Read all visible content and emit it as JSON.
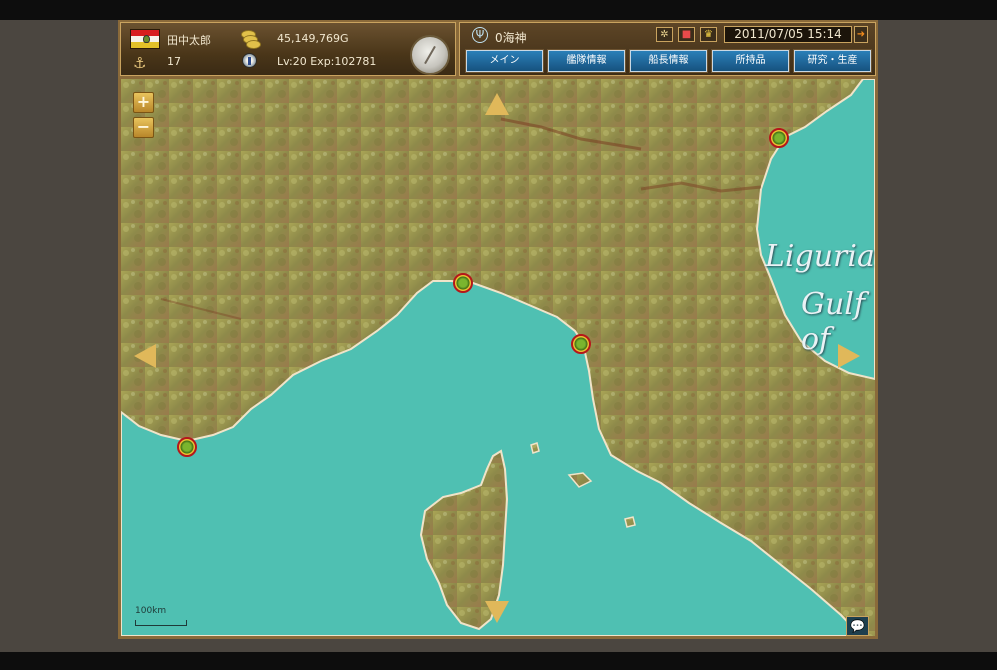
{
  "player": {
    "name": "田中太郎",
    "gold": "45,149,769G",
    "level_exp": "Lv:20 Exp:102781",
    "anchor_count": "17"
  },
  "ship": {
    "name": "0海神",
    "datetime": "2011/07/05 15:14"
  },
  "nav": {
    "buttons": [
      "メイン",
      "艦隊情報",
      "船長情報",
      "所持品",
      "研究・生産"
    ]
  },
  "map": {
    "zoom_in": "+",
    "zoom_out": "−",
    "scale_label": "100km",
    "sea_labels": [
      "Ligurian",
      "Gulf of"
    ],
    "colors": {
      "sea": "#4fc0b2",
      "land": "#9d9a4e",
      "coast": "#f0e4c9",
      "frame": "#c9a35f"
    }
  },
  "icons": [
    "flag-icon",
    "coin-stack-icon",
    "anchor-icon",
    "medal-icon",
    "compass-icon",
    "ship-wheel-icon",
    "port-icon",
    "chat-icon"
  ]
}
